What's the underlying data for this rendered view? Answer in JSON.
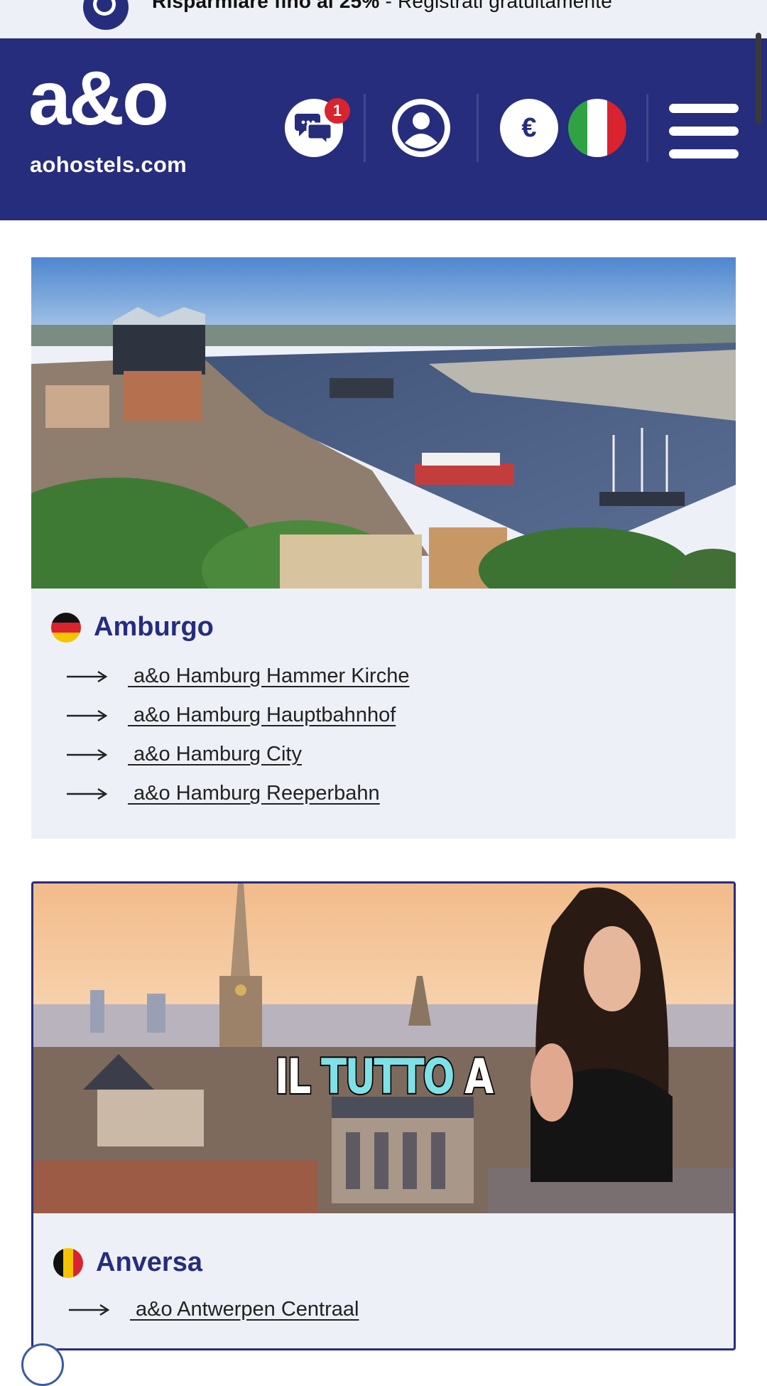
{
  "promo": {
    "bold_text": "Risparmiare fino al 25%",
    "rest_text": " - Registrati gratuitamente"
  },
  "header": {
    "logo_mark": "a&o",
    "logo_domain": "aohostels.com",
    "chat_badge_count": "1",
    "currency_symbol": "€",
    "icons": [
      "chat-icon",
      "user-icon",
      "euro-icon",
      "italy-flag-icon",
      "menu-icon"
    ],
    "brand_color": "#262d7c"
  },
  "destinations": [
    {
      "city": "Amburgo",
      "country_flag": "germany",
      "hostels": [
        " a&o Hamburg Hammer Kirche",
        " a&o Hamburg Hauptbahnhof",
        " a&o Hamburg City",
        " a&o Hamburg Reeperbahn"
      ]
    },
    {
      "city": "Anversa",
      "country_flag": "belgium",
      "hostels": [
        " a&o Antwerpen Centraal"
      ]
    }
  ],
  "overlay": {
    "caption_part1": "IL ",
    "caption_part2": "TUTTO",
    "caption_part3": " A"
  }
}
